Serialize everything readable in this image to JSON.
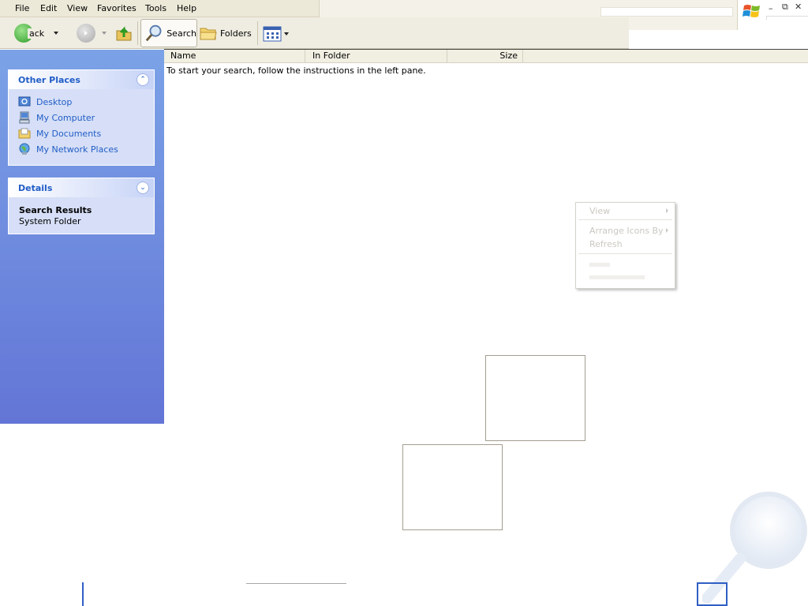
{
  "menu": {
    "items": [
      "File",
      "Edit",
      "View",
      "Favorites",
      "Tools",
      "Help"
    ]
  },
  "toolbar": {
    "back_label": "ack",
    "search_label": "Search",
    "folders_label": "Folders"
  },
  "task_pane": {
    "other_places": {
      "title": "Other Places",
      "items": [
        "Desktop",
        "My Computer",
        "My Documents",
        "My Network Places"
      ]
    },
    "details": {
      "title": "Details",
      "name": "Search Results",
      "type": "System Folder"
    }
  },
  "results": {
    "columns": [
      "Name",
      "In Folder",
      "Size"
    ],
    "instructions": "To start your search, follow the instructions in the left pane."
  },
  "context_menu": {
    "items": [
      "View",
      "Arrange Icons By",
      "Refresh"
    ]
  },
  "colors": {
    "task_pane_top": "#7ba2e7",
    "task_pane_bottom": "#6375d6",
    "link": "#215dc6",
    "chrome": "#ece9d8"
  }
}
